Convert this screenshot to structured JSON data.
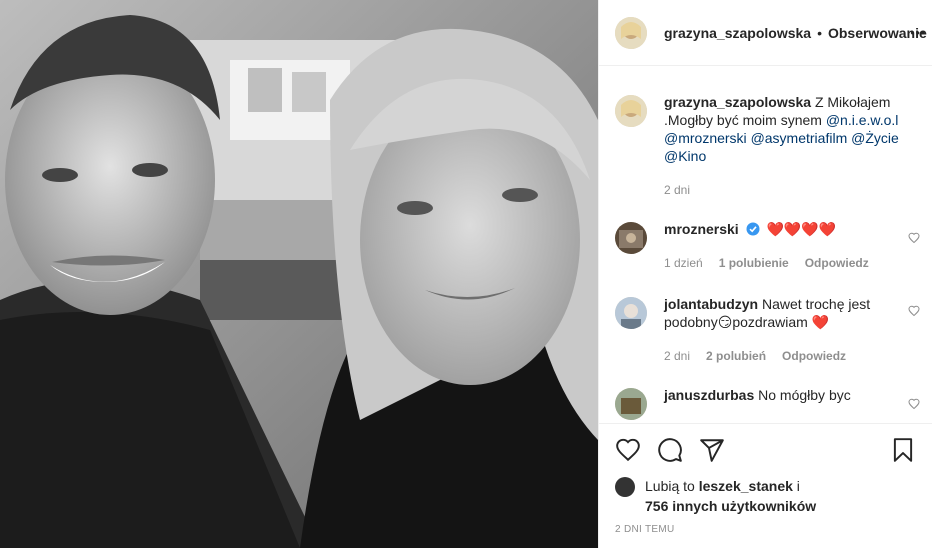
{
  "header": {
    "username": "grazyna_szapolowska",
    "separator": "•",
    "follow_label": "Obserwowanie",
    "more_icon": "ellipsis-icon"
  },
  "caption": {
    "username": "grazyna_szapolowska",
    "text": "Z Mikołajem .Mogłby być moim synem",
    "mentions": [
      "@n.i.e.w.o.l",
      "@mroznerski",
      "@asymetriafilm",
      "@Życie",
      "@Kino"
    ],
    "time": "2 dni"
  },
  "comments": [
    {
      "username": "mroznerski",
      "verified": true,
      "text": "❤️❤️❤️❤️",
      "time": "1 dzień",
      "likes": "1 polubienie",
      "reply": "Odpowiedz"
    },
    {
      "username": "jolantabudzyn",
      "text_a": "Nawet trochę jest podobny",
      "emoji": "😏",
      "text_b": "pozdrawiam",
      "heart": "❤️",
      "time": "2 dni",
      "likes": "2 polubień",
      "reply": "Odpowiedz"
    },
    {
      "username": "januszdurbas",
      "text": "No mógłby byc"
    }
  ],
  "likes_line": {
    "prefix": "Lubią to",
    "user": "leszek_stanek",
    "and": "i",
    "others": "756 innych użytkowników"
  },
  "timestamp": "2 dni temu",
  "colors": {
    "mention": "#00376b",
    "meta": "#8e8e8e",
    "verified": "#3897f0",
    "heart": "#ed1c24"
  }
}
